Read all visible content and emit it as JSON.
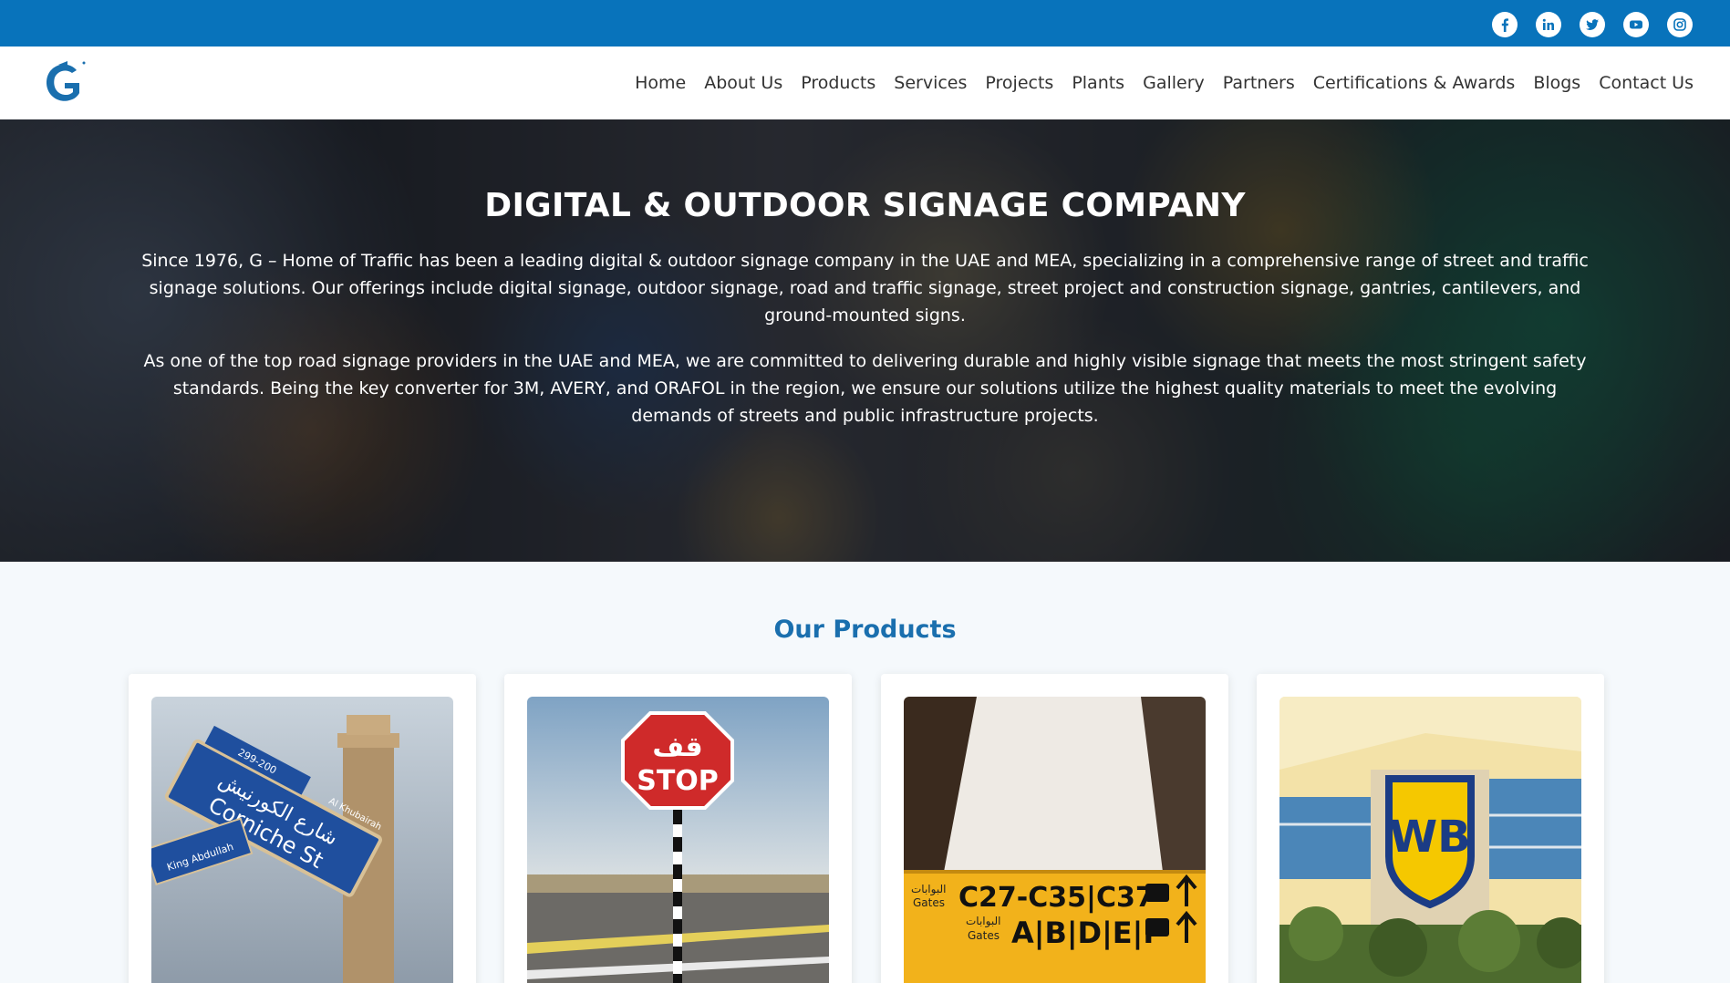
{
  "topbar": {
    "background": "#0873bb",
    "social": [
      {
        "icon": "facebook-icon"
      },
      {
        "icon": "linkedin-icon"
      },
      {
        "icon": "twitter-icon"
      },
      {
        "icon": "youtube-icon"
      },
      {
        "icon": "instagram-icon"
      }
    ]
  },
  "brand": {
    "logo_letter": "G",
    "color": "#1a6fae"
  },
  "nav": {
    "items": [
      "Home",
      "About Us",
      "Products",
      "Services",
      "Projects",
      "Plants",
      "Gallery",
      "Partners",
      "Certifications & Awards",
      "Blogs",
      "Contact Us"
    ]
  },
  "hero": {
    "title": "DIGITAL & OUTDOOR SIGNAGE COMPANY",
    "paragraph1": "Since 1976, G – Home of Traffic has been a leading digital & outdoor signage company in the UAE and MEA, specializing in a comprehensive range of street and traffic signage solutions. Our offerings include digital signage, outdoor signage, road and traffic signage, street project and construction signage, gantries, cantilevers, and ground-mounted signs.",
    "paragraph2": "As one of the top road signage providers in the UAE and MEA, we are committed to delivering durable and highly visible signage that meets the most stringent safety standards. Being the key converter for 3M, AVERY, and ORAFOL in the region, we ensure our solutions utilize the highest quality materials to meet the evolving demands of streets and public infrastructure projects."
  },
  "products": {
    "title": "Our Products",
    "cards": [
      {
        "image": "street-name-sign",
        "sign_arabic": "شارع الكورنيش",
        "sign_text": "Corniche St",
        "sign_small": "King Abdullah",
        "sign_number": "299-200",
        "sign_top": "Al Khubairah"
      },
      {
        "image": "stop-sign",
        "sign_arabic": "قف",
        "sign_text": "STOP"
      },
      {
        "image": "airport-gate-sign",
        "line1_arabic": "البوابات",
        "line1_label": "Gates",
        "line1_text": "C27-C35|C37",
        "line2_arabic": "البوابات",
        "line2_label": "Gates",
        "line2_text": "A|B|D|E|F"
      },
      {
        "image": "wb-logo-sign",
        "sign_text": "WB"
      }
    ]
  }
}
